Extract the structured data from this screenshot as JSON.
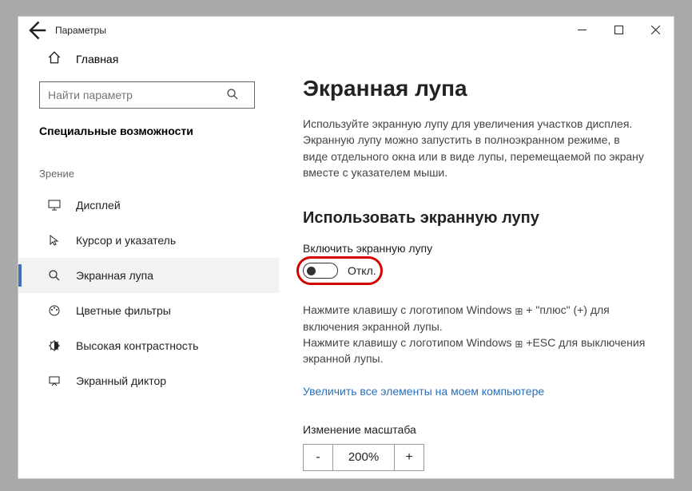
{
  "window": {
    "title": "Параметры"
  },
  "sidebar": {
    "home_label": "Главная",
    "search_placeholder": "Найти параметр",
    "section": "Специальные возможности",
    "group_label": "Зрение",
    "items": [
      {
        "label": "Дисплей"
      },
      {
        "label": "Курсор и указатель"
      },
      {
        "label": "Экранная лупа"
      },
      {
        "label": "Цветные фильтры"
      },
      {
        "label": "Высокая контрастность"
      },
      {
        "label": "Экранный диктор"
      }
    ]
  },
  "main": {
    "heading": "Экранная лупа",
    "desc": "Используйте экранную лупу для увеличения участков дисплея. Экранную лупу можно запустить в полноэкранном режиме, в виде отдельного окна или в виде лупы, перемещаемой по экрану вместе с указателем мыши.",
    "section_heading": "Использовать экранную лупу",
    "toggle_label": "Включить экранную лупу",
    "toggle_state": "Откл.",
    "hint1_a": "Нажмите клавишу с логотипом Windows ",
    "hint1_b": " + \"плюс\" (+) для включения экранной лупы.",
    "hint2_a": "Нажмите клавишу с логотипом Windows ",
    "hint2_b": " +ESC для выключения экранной лупы.",
    "link": "Увеличить все элементы на моем компьютере",
    "zoom_label": "Изменение масштаба",
    "zoom_minus": "-",
    "zoom_value": "200%",
    "zoom_plus": "+"
  }
}
